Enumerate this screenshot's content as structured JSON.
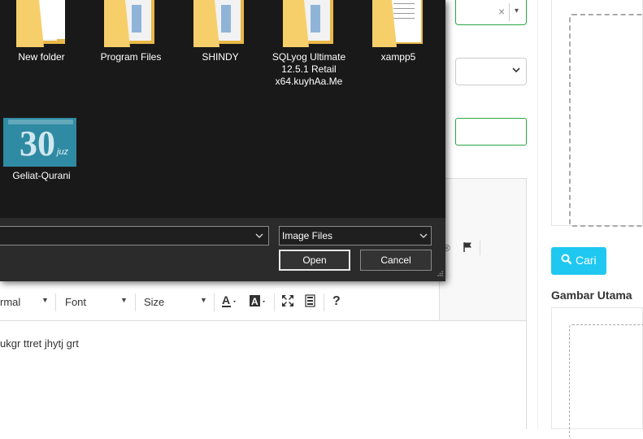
{
  "dialog": {
    "files": [
      {
        "name": "New folder",
        "icon": "folder-icon"
      },
      {
        "name": "Program Files",
        "icon": "folder-icon"
      },
      {
        "name": "SHINDY",
        "icon": "folder-icon"
      },
      {
        "name_lines": [
          "SQLyog Ultimate",
          "12.5.1 Retail",
          "x64.kuyhAa.Me"
        ],
        "icon": "folder-icon"
      },
      {
        "name": "xampp5",
        "icon": "folder-icon"
      },
      {
        "name": "Geliat-Qurani",
        "icon": "image-thumbnail",
        "thumb_text": "30",
        "thumb_sub": "juz"
      }
    ],
    "filename_value": "",
    "filetype_value": "Image Files",
    "open_label": "Open",
    "cancel_label": "Cancel"
  },
  "form": {
    "select1": {
      "clear": "×",
      "arrow": "▾"
    },
    "input3_value": ""
  },
  "editor": {
    "format_label": "rmal",
    "font_label": "Font",
    "size_label": "Size",
    "content": "ukgr ttret jhytj grt",
    "tools": [
      "text-color-icon",
      "background-color-icon",
      "maximize-icon",
      "show-blocks-icon",
      "help-icon"
    ]
  },
  "sidebar": {
    "cari_label": "Cari",
    "gambar_utama_title": "Gambar Utama"
  },
  "colors": {
    "dialog_bg": "#2b2b2b",
    "files_bg": "#191919",
    "success_border": "#28a745",
    "cari_bg": "#1fc8f0",
    "folder_yellow": "#f6cf6a"
  }
}
